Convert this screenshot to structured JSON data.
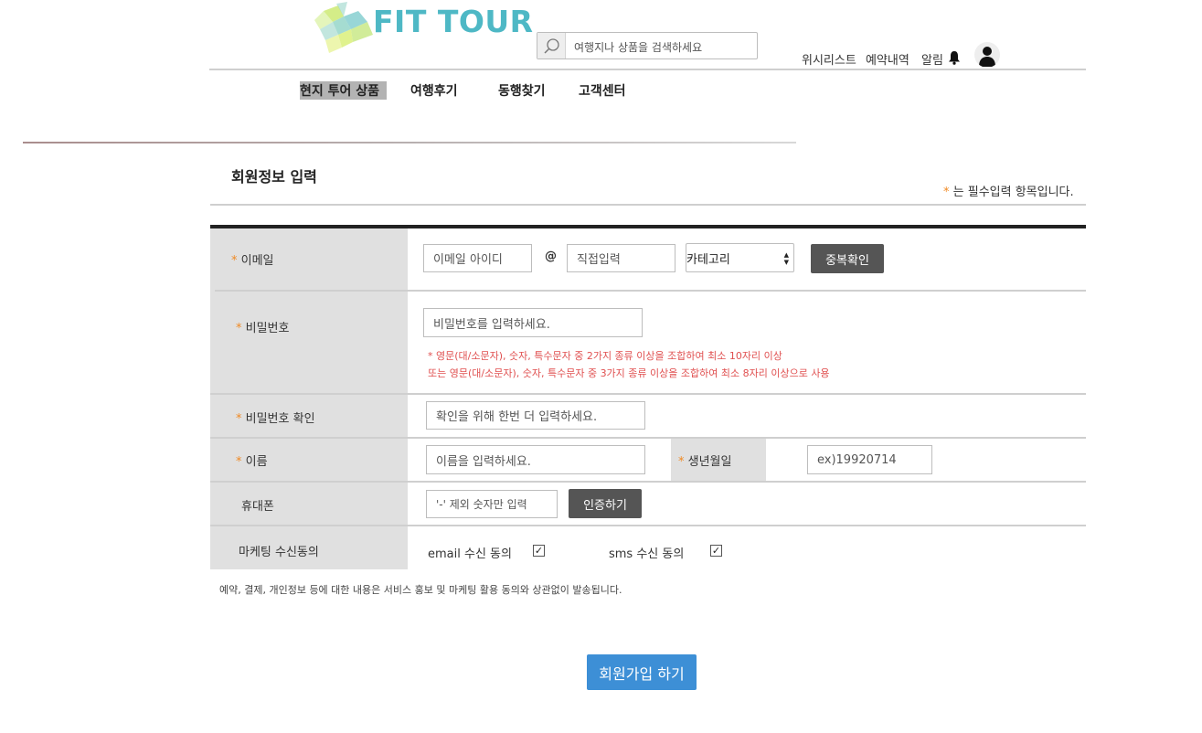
{
  "header": {
    "logo_text": "FIT TOUR",
    "search_placeholder": "여행지나 상품을 검색하세요",
    "links": {
      "wishlist": "위시리스트",
      "reservations": "예약내역",
      "notifications": "알림"
    },
    "icons": {
      "search": "search-icon",
      "bell": "bell-icon",
      "avatar": "user-avatar-icon"
    }
  },
  "nav": {
    "items": [
      {
        "label": "현지 투어 상품",
        "active": true
      },
      {
        "label": "여행후기",
        "active": false
      },
      {
        "label": "동행찾기",
        "active": false
      },
      {
        "label": "고객센터",
        "active": false
      }
    ]
  },
  "form": {
    "title": "회원정보 입력",
    "required_mark": "*",
    "required_note": "는 필수입력 항목입니다.",
    "email": {
      "label": "이메일",
      "id_placeholder": "이메일 아이디",
      "at": "@",
      "domain_placeholder": "직접입력",
      "category_selected": "카테고리",
      "check_button": "중복확인"
    },
    "password": {
      "label": "비밀번호",
      "placeholder": "비밀번호를 입력하세요.",
      "rule_line1": "* 영문(대/소문자), 숫자, 특수문자 중 2가지 종류 이상을 조합하여 최소 10자리 이상",
      "rule_line2": "또는 영문(대/소문자), 숫자, 특수문자 중 3가지 종류 이상을 조합하여 최소 8자리 이상으로 사용"
    },
    "password_confirm": {
      "label": "비밀번호 확인",
      "placeholder": "확인을 위해 한번 더 입력하세요."
    },
    "name": {
      "label": "이름",
      "placeholder": "이름을 입력하세요."
    },
    "birthdate": {
      "label": "생년월일",
      "placeholder": "ex)19920714"
    },
    "phone": {
      "label": "휴대폰",
      "placeholder": "'-' 제외 숫자만 입력",
      "verify_button": "인증하기"
    },
    "marketing": {
      "label": "마케팅 수신동의",
      "email_consent": "email 수신 동의",
      "sms_consent": "sms 수신 동의",
      "email_checked": true,
      "sms_checked": true,
      "check_glyph": "✓"
    },
    "notice": "예약, 결제, 개인정보 등에 대한 내용은 서비스 홍보 및 마케팅 활용 동의와 상관없이 발송됩니다.",
    "submit_label": "회원가입 하기"
  },
  "colors": {
    "brand": "#4eb8c5",
    "required_star": "#f08a24",
    "warning": "#e05050",
    "submit": "#3d8fd6",
    "dark_button": "#555555",
    "label_bg": "#e0e0e0"
  }
}
